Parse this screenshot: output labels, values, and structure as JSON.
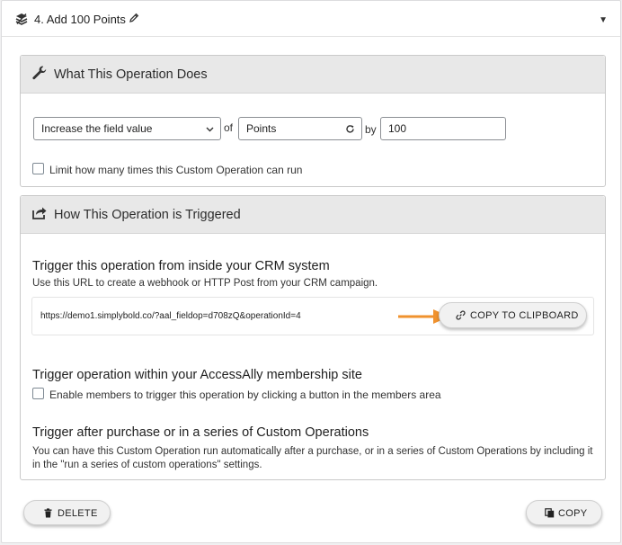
{
  "operation": {
    "title": "4. Add 100 Points"
  },
  "what_panel": {
    "title": "What This Operation Does",
    "action_select": "Increase the field value",
    "of_label": "of",
    "field_select": "Points",
    "by_label": "by",
    "amount_value": "100",
    "limit_checkbox_label": "Limit how many times this Custom Operation can run"
  },
  "trigger_panel": {
    "title": "How This Operation is Triggered",
    "crm_title": "Trigger this operation from inside your CRM system",
    "crm_desc": "Use this URL to create a webhook or HTTP Post from your CRM campaign.",
    "webhook_url": "https://demo1.simplybold.co/?aal_fieldop=d708zQ&operationId=4",
    "copy_clipboard_label": "COPY TO CLIPBOARD",
    "membership_title": "Trigger operation within your AccessAlly membership site",
    "membership_checkbox_label": "Enable members to trigger this operation by clicking a button in the members area",
    "purchase_title": "Trigger after purchase or in a series of Custom Operations",
    "purchase_desc": "You can have this Custom Operation run automatically after a purchase, or in a series of Custom Operations by including it in the \"run a series of custom operations\" settings."
  },
  "footer": {
    "delete_label": "DELETE",
    "copy_label": "COPY"
  },
  "colors": {
    "arrow": "#f0922e",
    "panel_header_bg": "#e8e8e8",
    "button_bg": "#f1f1f1"
  }
}
